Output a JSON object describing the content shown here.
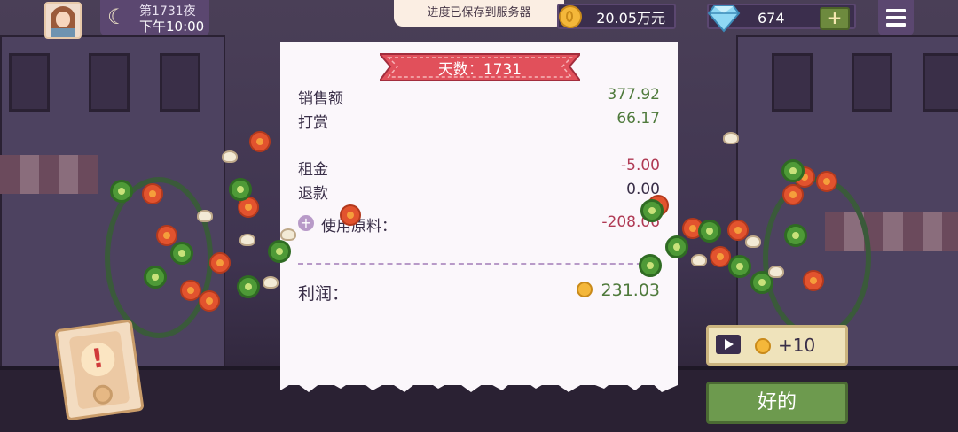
{
  "top_bar": {
    "night_label": "第1731夜",
    "time_label": "下午10:00",
    "save_toast": "进度已保存到服务器",
    "coins": "20.05万元",
    "gems": "674",
    "plus_label": "+"
  },
  "receipt": {
    "day_banner": "天数：1731",
    "rows": [
      {
        "label": "销售额",
        "value": "377.92"
      },
      {
        "label": "打赏",
        "value": "66.17"
      },
      {
        "label": "租金",
        "value": "-5.00"
      },
      {
        "label": "退款",
        "value": "0.00"
      },
      {
        "label": "使用原料：",
        "value": "-208.06"
      }
    ],
    "profit_label": "利润：",
    "profit_value": "231.03"
  },
  "buttons": {
    "ad_reward": "+10",
    "ok": "好的"
  },
  "colors": {
    "income": "#4f7a3c",
    "expense": "#b03a54",
    "banner": "#e1505b",
    "ok_button": "#6d9a4e"
  }
}
